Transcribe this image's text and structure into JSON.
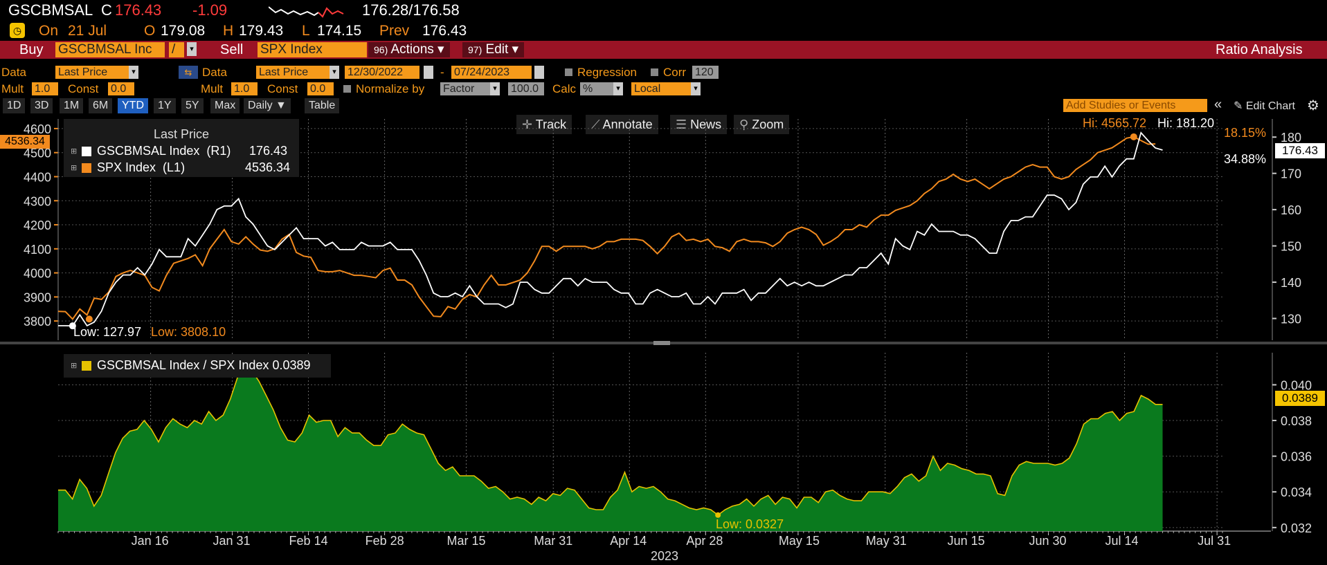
{
  "header": {
    "ticker": "GSCBMSAL",
    "c_label": "C",
    "last": "176.43",
    "change": "-1.09",
    "bid_ask": "176.28/176.58",
    "on_label": "On",
    "date": "21 Jul",
    "o_label": "O",
    "open": "179.08",
    "h_label": "H",
    "high": "179.43",
    "l_label": "L",
    "low": "174.15",
    "prev_label": "Prev",
    "prev": "176.43"
  },
  "toolbar": {
    "buy_label": "Buy",
    "buy_security": "GSCBMSAL Inc",
    "slash": "/",
    "sell_label": "Sell",
    "sell_security": "SPX Index",
    "actions_num": "96)",
    "actions_label": "Actions",
    "edit_num": "97)",
    "edit_label": "Edit",
    "title_right": "Ratio Analysis"
  },
  "controls": {
    "data_label": "Data",
    "data1": "Last Price",
    "data2": "Last Price",
    "date_from": "12/30/2022",
    "dash": "-",
    "date_to": "07/24/2023",
    "regression": "Regression",
    "corr": "Corr",
    "corr_val": "120",
    "mult_label": "Mult",
    "mult1": "1.0",
    "const_label": "Const",
    "const1": "0.0",
    "mult2": "1.0",
    "const2": "0.0",
    "normalize": "Normalize by",
    "factor": "Factor",
    "factor_val": "100.0",
    "calc": "Calc",
    "calc_val": "%",
    "local": "Local"
  },
  "tabs": [
    "1D",
    "3D",
    "1M",
    "6M",
    "YTD",
    "1Y",
    "5Y",
    "Max",
    "Daily ▼",
    "Table"
  ],
  "right_tools": {
    "add_studies": "Add Studies or Events",
    "collapse": "«",
    "edit_chart": "Edit Chart",
    "gear": "gear-icon"
  },
  "chart_tools": [
    "Track",
    "Annotate",
    "News",
    "Zoom"
  ],
  "legend": {
    "title": "Last Price",
    "s1": "GSCBMSAL Index  (R1)",
    "s1_val": "176.43",
    "s2": "SPX Index  (L1)",
    "s2_val": "4536.34"
  },
  "annotations": {
    "hi_spx": "Hi: 4565.72",
    "hi_gs": "Hi: 181.20",
    "pct_spx": "18.15%",
    "pct_gs": "34.88%",
    "low_gs": "Low: 127.97",
    "low_spx": "Low: 3808.10",
    "last_spx_tag": "4536.34",
    "last_gs_tag": "176.43",
    "ratio_legend": "GSCBMSAL Index / SPX Index 0.0389",
    "ratio_tag": "0.0389",
    "ratio_low": "Low: 0.0327"
  },
  "colors": {
    "gscbmsal": "#ffffff",
    "spx": "#f28a1e",
    "ratio_fill": "#0a7a1e",
    "ratio_line": "#e6c200",
    "accent_red": "#9a1325"
  },
  "chart_data": [
    {
      "type": "line",
      "x_start": "2022-12-30",
      "x_end": "2023-07-21",
      "x_ticks": [
        "Jan 16",
        "Jan 31",
        "Feb 14",
        "Feb 28",
        "Mar 15",
        "Mar 31",
        "Apr 14",
        "Apr 28",
        "May 15",
        "May 31",
        "Jun 15",
        "Jun 30",
        "Jul 14",
        "Jul 31"
      ],
      "x_year": "2023",
      "left_axis": {
        "ylim": [
          3720,
          4640
        ],
        "ticks": [
          3800,
          3900,
          4000,
          4100,
          4200,
          4300,
          4400,
          4500,
          4600
        ]
      },
      "right_axis": {
        "ylim": [
          124,
          185
        ],
        "ticks": [
          130,
          140,
          150,
          160,
          170,
          180
        ]
      },
      "series": [
        {
          "name": "GSCBMSAL Index  (R1)",
          "axis": "right",
          "values": [
            128,
            128,
            127.97,
            131,
            128,
            129,
            132,
            137,
            140,
            142,
            142,
            144,
            142,
            145,
            149,
            147,
            147,
            147,
            152,
            150,
            153,
            156,
            160,
            161,
            161,
            163,
            158,
            156,
            153,
            150,
            149,
            151,
            153,
            155,
            152,
            152,
            152,
            150,
            151,
            149,
            149,
            149,
            151,
            150,
            150,
            150,
            151,
            149,
            149,
            149,
            146,
            142,
            137,
            136,
            136,
            137,
            136,
            139,
            136,
            134,
            134,
            134,
            133,
            134,
            140,
            140,
            138,
            137,
            137,
            139,
            141,
            141,
            139,
            141,
            140,
            140,
            140,
            138,
            137,
            137,
            134,
            134,
            137,
            138,
            137,
            136,
            136,
            137,
            134,
            134,
            136,
            134,
            137,
            137,
            137,
            138,
            135,
            137,
            137,
            139,
            141,
            139,
            140,
            139,
            140,
            139,
            139,
            140,
            141,
            142,
            142,
            144,
            144,
            146,
            148,
            145,
            152,
            150,
            149,
            154,
            153,
            156,
            154,
            154,
            154,
            153,
            153,
            152,
            150,
            148,
            148,
            154,
            157,
            157,
            158,
            158,
            161,
            164,
            164,
            163,
            160,
            162,
            167,
            169,
            169,
            172,
            169,
            172,
            174,
            174,
            181.2,
            179,
            177,
            176.43
          ]
        },
        {
          "name": "SPX Index  (L1)",
          "axis": "left",
          "values": [
            3840,
            3839,
            3808,
            3850,
            3825,
            3895,
            3890,
            3920,
            3985,
            4000,
            4010,
            4000,
            3990,
            3940,
            3925,
            3990,
            4040,
            4050,
            4060,
            4075,
            4030,
            4100,
            4140,
            4180,
            4130,
            4120,
            4150,
            4120,
            4095,
            4090,
            4100,
            4140,
            4160,
            4085,
            4070,
            4065,
            4010,
            4005,
            4005,
            4010,
            4000,
            3990,
            3990,
            3985,
            3980,
            4010,
            4020,
            3970,
            3970,
            3950,
            3900,
            3860,
            3820,
            3818,
            3860,
            3850,
            3890,
            3910,
            3900,
            3950,
            3990,
            3950,
            3950,
            3960,
            3970,
            4000,
            4050,
            4110,
            4110,
            4090,
            4110,
            4110,
            4110,
            4110,
            4100,
            4110,
            4130,
            4130,
            4140,
            4140,
            4140,
            4135,
            4110,
            4080,
            4110,
            4150,
            4165,
            4135,
            4140,
            4130,
            4140,
            4110,
            4105,
            4090,
            4130,
            4140,
            4130,
            4130,
            4125,
            4110,
            4130,
            4165,
            4180,
            4190,
            4180,
            4160,
            4115,
            4130,
            4150,
            4180,
            4180,
            4200,
            4190,
            4220,
            4240,
            4240,
            4260,
            4270,
            4280,
            4300,
            4330,
            4350,
            4380,
            4390,
            4410,
            4390,
            4380,
            4390,
            4370,
            4350,
            4370,
            4390,
            4400,
            4420,
            4440,
            4450,
            4440,
            4440,
            4400,
            4390,
            4400,
            4430,
            4450,
            4470,
            4500,
            4510,
            4520,
            4540,
            4560,
            4565.72,
            4550,
            4535,
            4536.34
          ]
        }
      ]
    },
    {
      "type": "area",
      "name": "GSCBMSAL Index / SPX Index",
      "ylim": [
        0.0318,
        0.0418
      ],
      "ticks": [
        0.032,
        0.034,
        0.036,
        0.038,
        0.04
      ],
      "values": [
        0.0341,
        0.0341,
        0.0336,
        0.0347,
        0.0342,
        0.0332,
        0.0338,
        0.035,
        0.0362,
        0.037,
        0.0374,
        0.0375,
        0.038,
        0.0375,
        0.0368,
        0.0376,
        0.0381,
        0.0378,
        0.0376,
        0.038,
        0.0378,
        0.0385,
        0.038,
        0.0383,
        0.0392,
        0.0404,
        0.0409,
        0.0408,
        0.0402,
        0.0394,
        0.0386,
        0.0376,
        0.0369,
        0.0368,
        0.0373,
        0.0383,
        0.0379,
        0.038,
        0.038,
        0.0371,
        0.0376,
        0.0373,
        0.0373,
        0.0369,
        0.0366,
        0.0366,
        0.0372,
        0.0373,
        0.0378,
        0.0375,
        0.0373,
        0.0372,
        0.0364,
        0.0356,
        0.0352,
        0.0354,
        0.0349,
        0.0349,
        0.0349,
        0.0346,
        0.0342,
        0.0343,
        0.034,
        0.0336,
        0.0337,
        0.0336,
        0.0333,
        0.0337,
        0.0335,
        0.0339,
        0.0338,
        0.0342,
        0.0341,
        0.0336,
        0.0331,
        0.033,
        0.033,
        0.0337,
        0.0341,
        0.0351,
        0.034,
        0.0343,
        0.0342,
        0.0343,
        0.034,
        0.0336,
        0.0335,
        0.0333,
        0.0331,
        0.033,
        0.0331,
        0.033,
        0.0327,
        0.033,
        0.0332,
        0.0333,
        0.0336,
        0.0332,
        0.0336,
        0.0338,
        0.0333,
        0.0337,
        0.0336,
        0.0331,
        0.0337,
        0.0337,
        0.0334,
        0.034,
        0.0341,
        0.0338,
        0.0336,
        0.0335,
        0.0335,
        0.034,
        0.034,
        0.034,
        0.0339,
        0.0343,
        0.0348,
        0.035,
        0.0346,
        0.0349,
        0.036,
        0.0352,
        0.0356,
        0.0355,
        0.0353,
        0.0352,
        0.035,
        0.035,
        0.0349,
        0.0339,
        0.0338,
        0.0349,
        0.0355,
        0.0357,
        0.0356,
        0.0356,
        0.0356,
        0.0355,
        0.0356,
        0.0359,
        0.0367,
        0.0378,
        0.0381,
        0.0381,
        0.0384,
        0.0385,
        0.038,
        0.0384,
        0.0385,
        0.0394,
        0.0392,
        0.0389,
        0.0389
      ]
    }
  ]
}
